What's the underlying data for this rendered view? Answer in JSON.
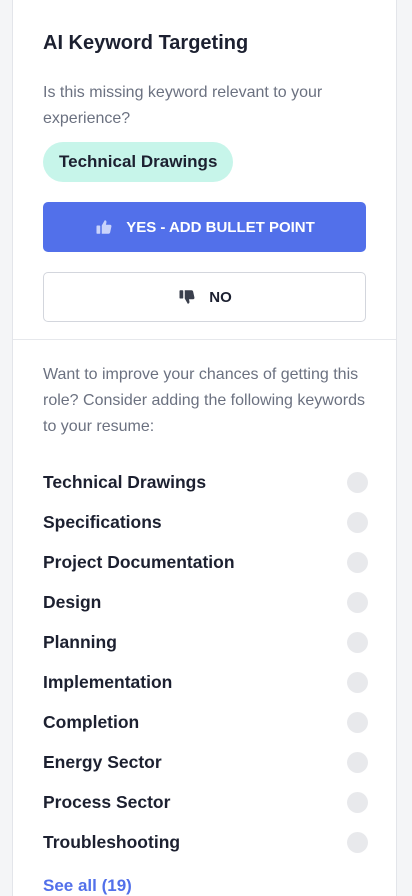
{
  "panel": {
    "title": "AI Keyword Targeting",
    "question": "Is this missing keyword relevant to your experience?",
    "current_keyword": "Technical Drawings",
    "yes_button": {
      "label": "YES - ADD BULLET POINT",
      "icon": "thumbs-up-icon"
    },
    "no_button": {
      "label": "NO",
      "icon": "thumbs-down-icon"
    }
  },
  "suggestions": {
    "intro": "Want to improve your chances of getting this role? Consider adding the following keywords to your resume:",
    "keywords": [
      {
        "label": "Technical Drawings",
        "checked": false
      },
      {
        "label": "Specifications",
        "checked": false
      },
      {
        "label": "Project Documentation",
        "checked": false
      },
      {
        "label": "Design",
        "checked": false
      },
      {
        "label": "Planning",
        "checked": false
      },
      {
        "label": "Implementation",
        "checked": false
      },
      {
        "label": "Completion",
        "checked": false
      },
      {
        "label": "Energy Sector",
        "checked": false
      },
      {
        "label": "Process Sector",
        "checked": false
      },
      {
        "label": "Troubleshooting",
        "checked": false
      }
    ],
    "see_all_label": "See all (19)"
  },
  "colors": {
    "accent": "#5270ea",
    "pill_bg": "#c7f5ea",
    "text_primary": "#1c2030",
    "text_muted": "#6b7180",
    "dot": "#e8e9ec"
  }
}
